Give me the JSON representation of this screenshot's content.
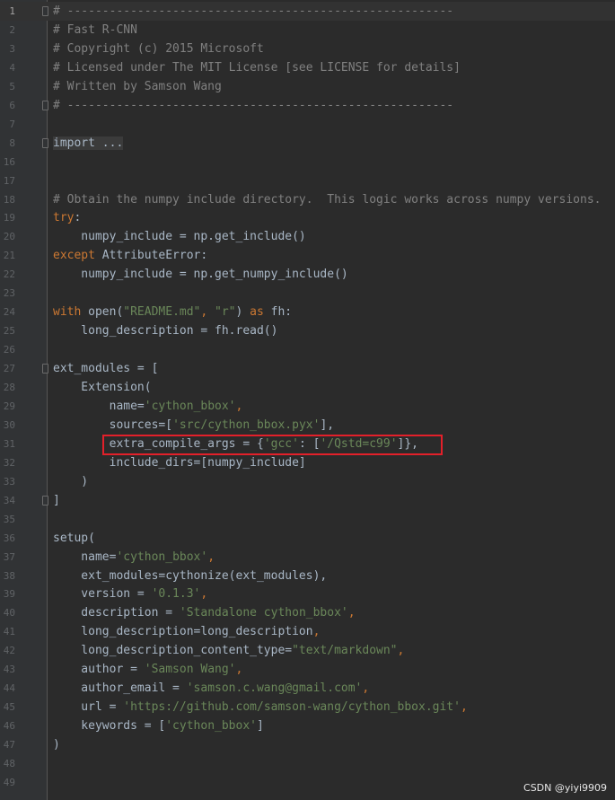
{
  "colors": {
    "background": "#2b2b2b",
    "gutter": "#313335",
    "text": "#a9b7c6",
    "comment": "#808080",
    "keyword": "#cc7832",
    "string": "#6a8759",
    "highlight_box": "#e3202a"
  },
  "lines": [
    {
      "number": "1",
      "current": true,
      "fold": true,
      "tokens": [
        {
          "t": "# -------------------------------------------------------",
          "c": "comment"
        }
      ]
    },
    {
      "number": "2",
      "tokens": [
        {
          "t": "# Fast R-CNN",
          "c": "comment"
        }
      ]
    },
    {
      "number": "3",
      "tokens": [
        {
          "t": "# Copyright (c) 2015 Microsoft",
          "c": "comment"
        }
      ]
    },
    {
      "number": "4",
      "tokens": [
        {
          "t": "# Licensed under The MIT License [see LICENSE for details]",
          "c": "comment"
        }
      ]
    },
    {
      "number": "5",
      "tokens": [
        {
          "t": "# Written by Samson Wang",
          "c": "comment"
        }
      ]
    },
    {
      "number": "6",
      "fold": true,
      "tokens": [
        {
          "t": "# -------------------------------------------------------",
          "c": "comment"
        }
      ]
    },
    {
      "number": "7",
      "tokens": []
    },
    {
      "number": "8",
      "fold": true,
      "tokens": [
        {
          "t": "import ...",
          "c": "folded"
        }
      ]
    },
    {
      "number": "16",
      "tokens": []
    },
    {
      "number": "17",
      "tokens": []
    },
    {
      "number": "18",
      "tokens": [
        {
          "t": "# Obtain the numpy include directory.  This logic works across numpy versions.",
          "c": "comment"
        }
      ]
    },
    {
      "number": "19",
      "tokens": [
        {
          "t": "try",
          "c": "keyword"
        },
        {
          "t": ":",
          "c": "plain"
        }
      ]
    },
    {
      "number": "20",
      "tokens": [
        {
          "t": "    numpy_include = np.get_include()",
          "c": "plain"
        }
      ]
    },
    {
      "number": "21",
      "tokens": [
        {
          "t": "except",
          "c": "keyword"
        },
        {
          "t": " AttributeError:",
          "c": "plain"
        }
      ]
    },
    {
      "number": "22",
      "tokens": [
        {
          "t": "    numpy_include = np.get_numpy_include()",
          "c": "plain"
        }
      ]
    },
    {
      "number": "23",
      "tokens": []
    },
    {
      "number": "24",
      "tokens": [
        {
          "t": "with",
          "c": "keyword"
        },
        {
          "t": " open(",
          "c": "plain"
        },
        {
          "t": "\"README.md\"",
          "c": "string"
        },
        {
          "t": ", ",
          "c": "keyword"
        },
        {
          "t": "\"r\"",
          "c": "string"
        },
        {
          "t": ") ",
          "c": "plain"
        },
        {
          "t": "as",
          "c": "keyword"
        },
        {
          "t": " fh:",
          "c": "plain"
        }
      ]
    },
    {
      "number": "25",
      "tokens": [
        {
          "t": "    long_description = fh.read()",
          "c": "plain"
        }
      ]
    },
    {
      "number": "26",
      "tokens": []
    },
    {
      "number": "27",
      "fold": true,
      "tokens": [
        {
          "t": "ext_modules = [",
          "c": "plain"
        }
      ]
    },
    {
      "number": "28",
      "tokens": [
        {
          "t": "    Extension(",
          "c": "plain"
        }
      ]
    },
    {
      "number": "29",
      "tokens": [
        {
          "t": "        name=",
          "c": "plain"
        },
        {
          "t": "'cython_bbox'",
          "c": "string"
        },
        {
          "t": ",",
          "c": "keyword"
        }
      ]
    },
    {
      "number": "30",
      "tokens": [
        {
          "t": "        sources=[",
          "c": "plain"
        },
        {
          "t": "'src/cython_bbox.pyx'",
          "c": "string"
        },
        {
          "t": "],",
          "c": "plain"
        }
      ]
    },
    {
      "number": "31",
      "tokens": [
        {
          "t": "        extra_compile_args = {",
          "c": "plain"
        },
        {
          "t": "'gcc'",
          "c": "string"
        },
        {
          "t": ": [",
          "c": "plain"
        },
        {
          "t": "'/Qstd=c99'",
          "c": "string"
        },
        {
          "t": "]},",
          "c": "plain"
        }
      ]
    },
    {
      "number": "32",
      "tokens": [
        {
          "t": "        include_dirs=[numpy_include]",
          "c": "plain"
        }
      ]
    },
    {
      "number": "33",
      "tokens": [
        {
          "t": "    )",
          "c": "plain"
        }
      ]
    },
    {
      "number": "34",
      "fold": true,
      "tokens": [
        {
          "t": "]",
          "c": "plain"
        }
      ]
    },
    {
      "number": "35",
      "tokens": []
    },
    {
      "number": "36",
      "tokens": [
        {
          "t": "setup(",
          "c": "plain"
        }
      ]
    },
    {
      "number": "37",
      "tokens": [
        {
          "t": "    name=",
          "c": "plain"
        },
        {
          "t": "'cython_bbox'",
          "c": "string"
        },
        {
          "t": ",",
          "c": "keyword"
        }
      ]
    },
    {
      "number": "38",
      "tokens": [
        {
          "t": "    ext_modules=cythonize(ext_modules),",
          "c": "plain"
        }
      ]
    },
    {
      "number": "39",
      "tokens": [
        {
          "t": "    version = ",
          "c": "plain"
        },
        {
          "t": "'0.1.3'",
          "c": "string"
        },
        {
          "t": ",",
          "c": "keyword"
        }
      ]
    },
    {
      "number": "40",
      "tokens": [
        {
          "t": "    description = ",
          "c": "plain"
        },
        {
          "t": "'Standalone cython_bbox'",
          "c": "string"
        },
        {
          "t": ",",
          "c": "keyword"
        }
      ]
    },
    {
      "number": "41",
      "tokens": [
        {
          "t": "    long_description=long_description",
          "c": "plain"
        },
        {
          "t": ",",
          "c": "keyword"
        }
      ]
    },
    {
      "number": "42",
      "tokens": [
        {
          "t": "    long_description_content_type=",
          "c": "plain"
        },
        {
          "t": "\"text/markdown\"",
          "c": "string"
        },
        {
          "t": ",",
          "c": "keyword"
        }
      ]
    },
    {
      "number": "43",
      "tokens": [
        {
          "t": "    author = ",
          "c": "plain"
        },
        {
          "t": "'Samson Wang'",
          "c": "string"
        },
        {
          "t": ",",
          "c": "keyword"
        }
      ]
    },
    {
      "number": "44",
      "tokens": [
        {
          "t": "    author_email = ",
          "c": "plain"
        },
        {
          "t": "'samson.c.wang@gmail.com'",
          "c": "string"
        },
        {
          "t": ",",
          "c": "keyword"
        }
      ]
    },
    {
      "number": "45",
      "tokens": [
        {
          "t": "    url = ",
          "c": "plain"
        },
        {
          "t": "'https://github.com/samson-wang/cython_bbox.git'",
          "c": "string"
        },
        {
          "t": ",",
          "c": "keyword"
        }
      ]
    },
    {
      "number": "46",
      "tokens": [
        {
          "t": "    keywords = [",
          "c": "plain"
        },
        {
          "t": "'cython_bbox'",
          "c": "string"
        },
        {
          "t": "]",
          "c": "plain"
        }
      ]
    },
    {
      "number": "47",
      "tokens": [
        {
          "t": ")",
          "c": "plain"
        }
      ]
    },
    {
      "number": "48",
      "tokens": []
    },
    {
      "number": "49",
      "tokens": []
    }
  ],
  "watermark": "CSDN @yiyi9909"
}
